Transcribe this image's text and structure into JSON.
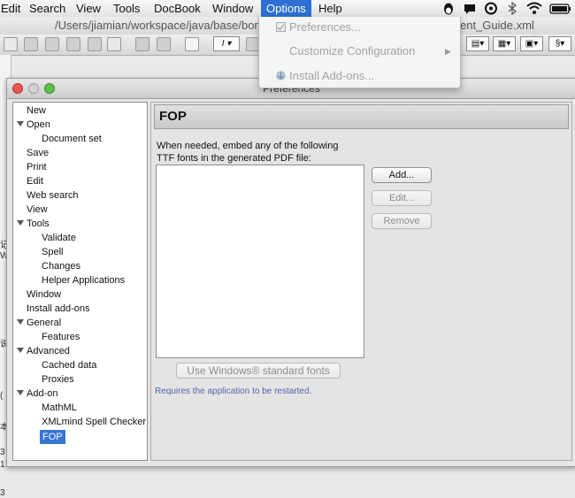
{
  "menubar": {
    "items": [
      "Edit",
      "Search",
      "View",
      "Tools",
      "DocBook",
      "Window",
      "Options",
      "Help"
    ],
    "active": "Options",
    "tray_icons": [
      "qq-penguin-icon",
      "chat-bubble-icon",
      "sync-circle-icon",
      "bluetooth-icon",
      "wifi-icon",
      "battery-icon"
    ]
  },
  "pathbar": {
    "left": "/Users/jiamian/workspace/java/base/bonc",
    "right": "ent_Guide.xml"
  },
  "options_menu": {
    "items": [
      {
        "label": "Preferences...",
        "icon": "preferences-icon",
        "enabled": false
      },
      {
        "label": "Customize Configuration",
        "submenu": true,
        "enabled": false
      },
      {
        "label": "Install Add-ons...",
        "icon": "install-addons-icon",
        "enabled": false
      }
    ]
  },
  "preferences": {
    "window_title": "Preferences",
    "tree": [
      {
        "label": "New",
        "level": 0
      },
      {
        "label": "Open",
        "level": 0,
        "expanded": true
      },
      {
        "label": "Document set",
        "level": 1
      },
      {
        "label": "Save",
        "level": 0
      },
      {
        "label": "Print",
        "level": 0
      },
      {
        "label": "Edit",
        "level": 0
      },
      {
        "label": "Web search",
        "level": 0
      },
      {
        "label": "View",
        "level": 0
      },
      {
        "label": "Tools",
        "level": 0,
        "expanded": true
      },
      {
        "label": "Validate",
        "level": 1
      },
      {
        "label": "Spell",
        "level": 1
      },
      {
        "label": "Changes",
        "level": 1
      },
      {
        "label": "Helper Applications",
        "level": 1
      },
      {
        "label": "Window",
        "level": 0
      },
      {
        "label": "Install add-ons",
        "level": 0
      },
      {
        "label": "General",
        "level": 0,
        "expanded": true
      },
      {
        "label": "Features",
        "level": 1
      },
      {
        "label": "Advanced",
        "level": 0,
        "expanded": true
      },
      {
        "label": "Cached data",
        "level": 1
      },
      {
        "label": "Proxies",
        "level": 1
      },
      {
        "label": "Add-on",
        "level": 0,
        "expanded": true
      },
      {
        "label": "MathML",
        "level": 1
      },
      {
        "label": "XMLmind Spell Checker",
        "level": 1
      },
      {
        "label": "FOP",
        "level": 1,
        "selected": true
      }
    ],
    "panel": {
      "title": "FOP",
      "description_line1": "When needed, embed any of the following",
      "description_line2": "TTF fonts in the generated PDF file:",
      "add_button": "Add...",
      "edit_button": "Edit...",
      "remove_button": "Remove",
      "windows_fonts_button": "Use Windows® standard fonts",
      "restart_note": "Requires the application to be restarted."
    }
  },
  "editor_margin_glyphs": [
    "记",
    "W",
    "说",
    "(",
    "本",
    "3",
    "1",
    "3"
  ],
  "colors": {
    "menu_highlight": "#2e6fd3",
    "selection": "#3875d7",
    "note_text": "#5863b0"
  }
}
